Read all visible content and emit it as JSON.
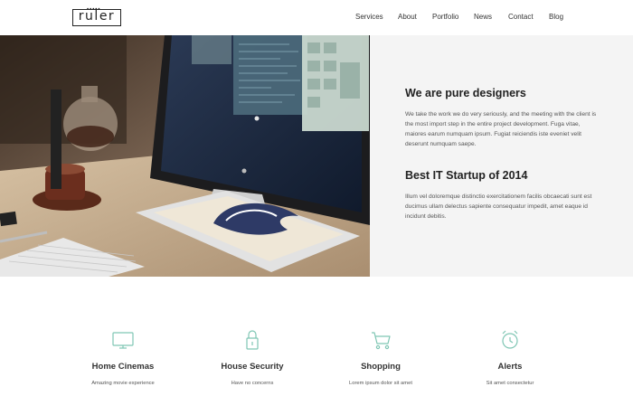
{
  "brand": {
    "logo_text": "ruler"
  },
  "nav": {
    "items": [
      {
        "label": "Services"
      },
      {
        "label": "About"
      },
      {
        "label": "Portfolio"
      },
      {
        "label": "News"
      },
      {
        "label": "Contact"
      },
      {
        "label": "Blog"
      }
    ]
  },
  "hero": {
    "heading_1": "We are pure designers",
    "paragraph_1": "We take the work we do very seriously, and the meeting with the client is the most import step in the entire project development. Fuga vitae, maiores earum numquam ipsum. Fugiat reiciendis iste eveniet velit deserunt numquam saepe.",
    "heading_2": "Best IT Startup of 2014",
    "paragraph_2": "Illum vel doloremque distinctio exercitationem facilis obcaecati sunt est ducimus ullam delectus sapiente consequatur impedit, amet eaque id incidunt debitis."
  },
  "features": [
    {
      "icon": "tv-icon",
      "title": "Home Cinemas",
      "subtitle": "Amazing movie experience"
    },
    {
      "icon": "lock-icon",
      "title": "House Security",
      "subtitle": "Have no concerns"
    },
    {
      "icon": "cart-icon",
      "title": "Shopping",
      "subtitle": "Lorem ipsum dolor sit amet"
    },
    {
      "icon": "alarm-clock-icon",
      "title": "Alerts",
      "subtitle": "Sit amet consectetur"
    }
  ],
  "colors": {
    "accent": "#7fc6b4",
    "hero_text_bg": "#f4f4f4",
    "text_dark": "#222222"
  }
}
